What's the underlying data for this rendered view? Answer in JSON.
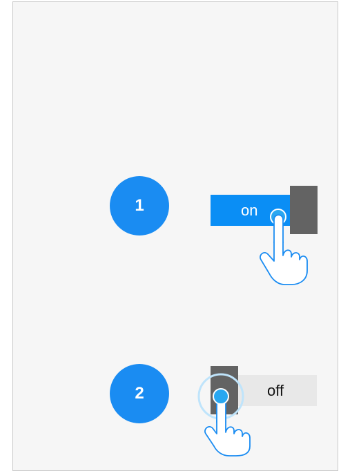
{
  "steps": [
    {
      "number": "1",
      "toggle_label": "on",
      "state": "on"
    },
    {
      "number": "2",
      "toggle_label": "off",
      "state": "off"
    }
  ],
  "colors": {
    "badge": "#1a8cf2",
    "toggle_on_track": "#0a8ef5",
    "toggle_off_track": "#e8e8e8",
    "thumb": "#636363",
    "touch_point": "#29a7f0",
    "panel_background": "#f6f6f6"
  },
  "icons": {
    "pointer": "pointing-hand-icon",
    "touch": "touch-point-icon"
  }
}
